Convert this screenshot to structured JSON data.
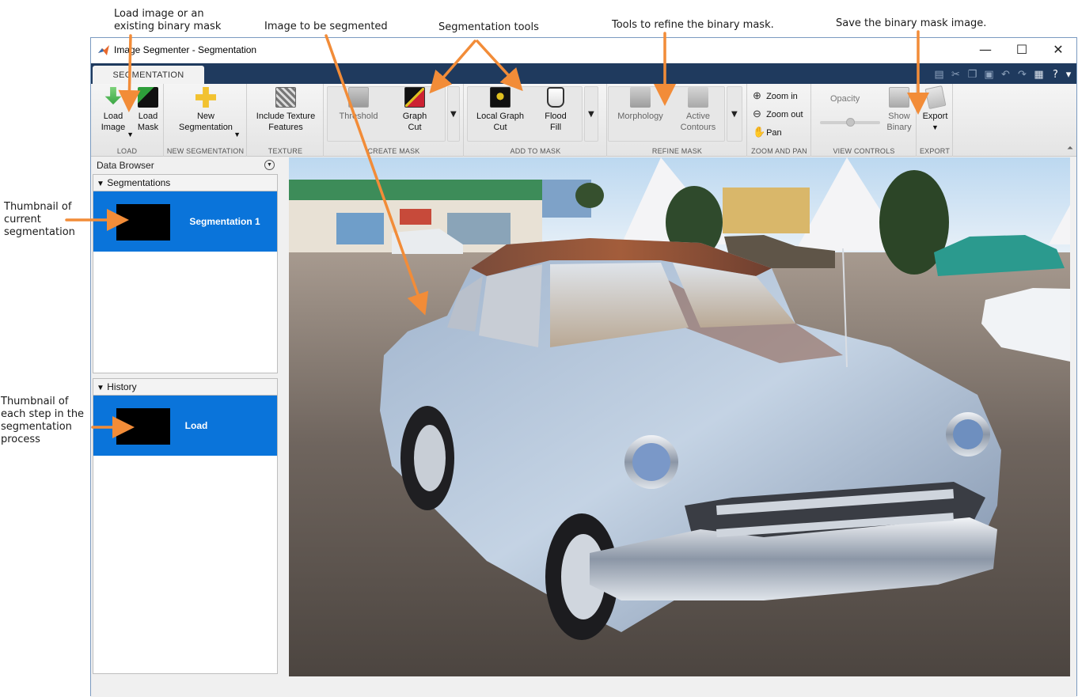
{
  "annotations": {
    "load": "Load image or an existing binary mask",
    "image": "Image to be segmented",
    "seg_tools": "Segmentation tools",
    "refine": "Tools to refine the binary mask.",
    "save": "Save the binary mask image.",
    "thumb_current": "Thumbnail of current segmentation",
    "thumb_history": "Thumbnail of each step in the segmentation process",
    "arrow_color": "#f28c38"
  },
  "window": {
    "title": "Image Segmenter - Segmentation",
    "tab": "SEGMENTATION",
    "minimize_glyph": "—",
    "maximize_glyph": "☐",
    "close_glyph": "✕"
  },
  "ribbon": {
    "load": {
      "section": "LOAD",
      "load_image": "Load Image",
      "load_mask": "Load Mask"
    },
    "new_segmentation": {
      "section": "NEW SEGMENTATION",
      "new_segmentation": "New Segmentation"
    },
    "texture": {
      "section": "TEXTURE",
      "include_texture": "Include Texture Features"
    },
    "create_mask": {
      "section": "CREATE MASK",
      "threshold": "Threshold",
      "graph_cut": "Graph Cut"
    },
    "add_to_mask": {
      "section": "ADD TO MASK",
      "local_graph_cut": "Local Graph Cut",
      "flood_fill": "Flood Fill"
    },
    "refine_mask": {
      "section": "REFINE MASK",
      "morphology": "Morphology",
      "active_contours": "Active Contours"
    },
    "zoom_pan": {
      "section": "ZOOM AND PAN",
      "zoom_in": "Zoom in",
      "zoom_out": "Zoom out",
      "pan": "Pan"
    },
    "view_controls": {
      "section": "VIEW CONTROLS",
      "opacity": "Opacity",
      "show_binary": "Show Binary"
    },
    "export": {
      "section": "EXPORT",
      "export": "Export"
    }
  },
  "data_browser": {
    "title": "Data Browser",
    "segmentations_header": "Segmentations",
    "segmentation_item": "Segmentation 1",
    "history_header": "History",
    "history_item": "Load"
  },
  "colors": {
    "accent_blue": "#0a74da",
    "tab_strip": "#1f3a5e"
  }
}
